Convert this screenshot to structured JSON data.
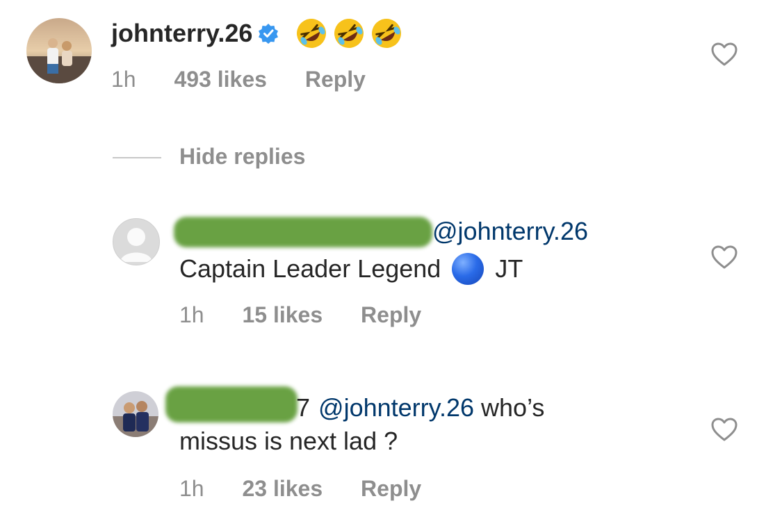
{
  "colors": {
    "mention": "#00376b",
    "meta": "#8e8e8e",
    "verified": "#3897f0",
    "redaction": "#5d9a34",
    "blue_circle": "#1f5fd9"
  },
  "comment": {
    "username": "johnterry.26",
    "verified_icon": "verified-badge-icon",
    "emoji": [
      "rolling-on-floor-laughing-emoji",
      "rolling-on-floor-laughing-emoji",
      "rolling-on-floor-laughing-emoji"
    ],
    "time": "1h",
    "likes": "493 likes",
    "reply": "Reply"
  },
  "replies_toggle": "Hide replies",
  "replies": [
    {
      "username_visible": "",
      "mention": "@johnterry.26",
      "text_line2_a": "Captain Leader Legend",
      "text_line2_b": "JT",
      "time": "1h",
      "likes": "15 likes",
      "reply": "Reply"
    },
    {
      "username_visible": "7",
      "mention": "@johnterry.26",
      "text_after_mention": "who’s",
      "text_line2": "missus is next lad ?",
      "time": "1h",
      "likes": "23 likes",
      "reply": "Reply"
    }
  ]
}
